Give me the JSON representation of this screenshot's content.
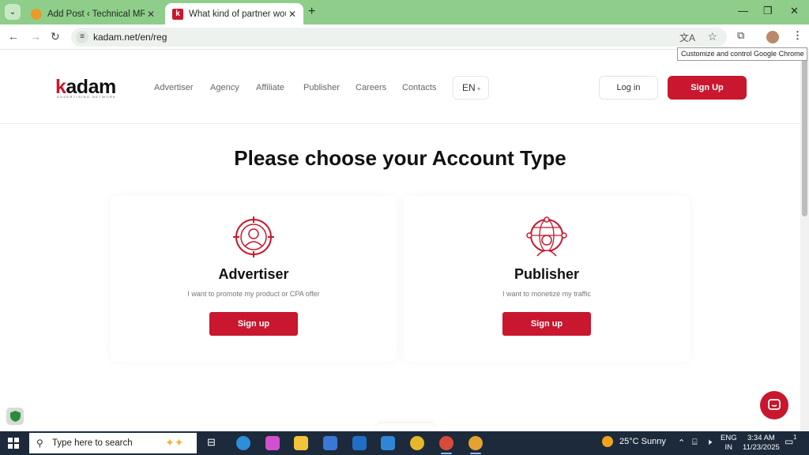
{
  "browser": {
    "tabs": [
      {
        "title": "Add Post ‹ Technical MR Rajasth",
        "active": false
      },
      {
        "title": "What kind of partner would you",
        "active": true
      }
    ],
    "url": "kadam.net/en/reg",
    "tooltip": "Customize and control Google Chrome"
  },
  "site": {
    "logo": {
      "k": "k",
      "rest": "adam",
      "tagline": "ADVERTISING NETWORK"
    },
    "nav": [
      "Advertiser",
      "Agency",
      "Affiliate",
      "Publisher",
      "Careers",
      "Contacts"
    ],
    "lang": "EN",
    "login": "Log in",
    "signup": "Sign Up",
    "accent": "#c8172e"
  },
  "main": {
    "heading": "Please choose your Account Type",
    "cards": [
      {
        "title": "Advertiser",
        "desc": "I want to promote my product or CPA offer",
        "button": "Sign up",
        "icon": "target-person-icon"
      },
      {
        "title": "Publisher",
        "desc": "I want to monetize my traffic",
        "button": "Sign up",
        "icon": "globe-person-icon"
      }
    ]
  },
  "taskbar": {
    "search_placeholder": "Type here to search",
    "weather": "25°C  Sunny",
    "lang": [
      "ENG",
      "IN"
    ],
    "time": "3:34 AM",
    "date": "11/23/2025",
    "notifications": "1"
  }
}
